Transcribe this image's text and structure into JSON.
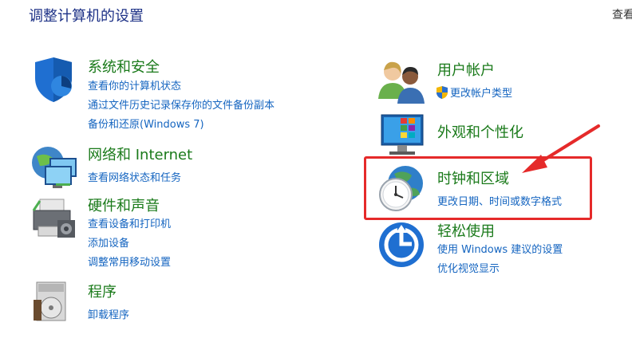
{
  "page": {
    "title": "调整计算机的设置",
    "view_by_label": "查看"
  },
  "categories": {
    "system": {
      "title": "系统和安全",
      "links": [
        "查看你的计算机状态",
        "通过文件历史记录保存你的文件备份副本",
        "备份和还原(Windows 7)"
      ]
    },
    "network": {
      "title": "网络和 Internet",
      "links": [
        "查看网络状态和任务"
      ]
    },
    "hardware": {
      "title": "硬件和声音",
      "links": [
        "查看设备和打印机",
        "添加设备",
        "调整常用移动设置"
      ]
    },
    "programs": {
      "title": "程序",
      "links": [
        "卸载程序"
      ]
    },
    "user": {
      "title": "用户帐户",
      "links": [
        "更改帐户类型"
      ]
    },
    "appearance": {
      "title": "外观和个性化",
      "links": []
    },
    "clock": {
      "title": "时钟和区域",
      "links": [
        "更改日期、时间或数字格式"
      ]
    },
    "ease": {
      "title": "轻松使用",
      "links": [
        "使用 Windows 建议的设置",
        "优化视觉显示"
      ]
    }
  },
  "annotation": {
    "highlight_color": "#e52a2a"
  }
}
